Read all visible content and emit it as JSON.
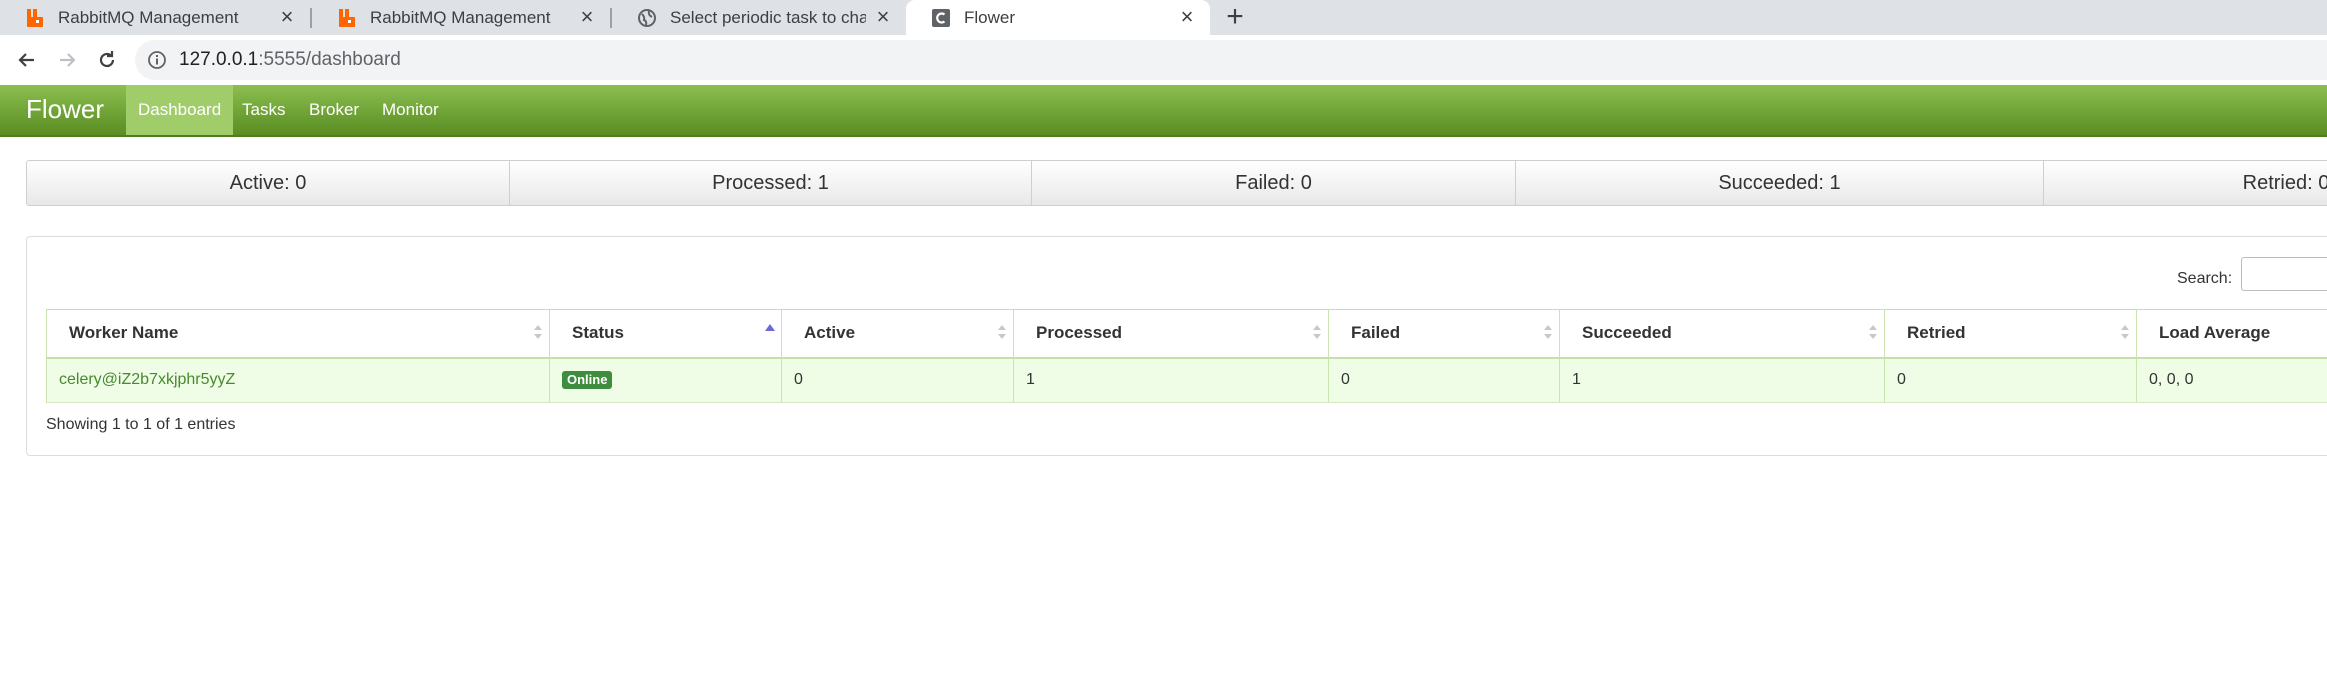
{
  "browser": {
    "tabs": [
      {
        "title": "RabbitMQ Management",
        "icon": "rabbitmq-icon"
      },
      {
        "title": "RabbitMQ Management",
        "icon": "rabbitmq-icon"
      },
      {
        "title": "Select periodic task to change",
        "icon": "globe-icon"
      },
      {
        "title": "Flower",
        "icon": "celery-c-icon"
      }
    ],
    "close_glyph": "×",
    "new_tab_glyph": "+",
    "url_host": "127.0.0.1",
    "url_path": ":5555/dashboard"
  },
  "navbar": {
    "brand": "Flower",
    "links": [
      "Dashboard",
      "Tasks",
      "Broker",
      "Monitor"
    ],
    "active_link": "Dashboard"
  },
  "stats": {
    "active": "Active: 0",
    "processed": "Processed: 1",
    "failed": "Failed: 0",
    "succeeded": "Succeeded: 1",
    "retried": "Retried: 0"
  },
  "search": {
    "label": "Search:",
    "value": ""
  },
  "table": {
    "columns": [
      "Worker Name",
      "Status",
      "Active",
      "Processed",
      "Failed",
      "Succeeded",
      "Retried",
      "Load Average"
    ],
    "rows": [
      {
        "worker_name": "celery@iZ2b7xkjphr5yyZ",
        "status": "Online",
        "active": "0",
        "processed": "1",
        "failed": "0",
        "succeeded": "1",
        "retried": "0",
        "load_average": "0, 0, 0"
      }
    ],
    "info": "Showing 1 to 1 of 1 entries"
  },
  "colors": {
    "navbar_top": "#8cbf4f",
    "navbar_bottom": "#5a8d22",
    "row_bg": "#f0fde6",
    "status_badge": "#3e8c3e",
    "rabbitmq_orange": "#ff6600"
  }
}
